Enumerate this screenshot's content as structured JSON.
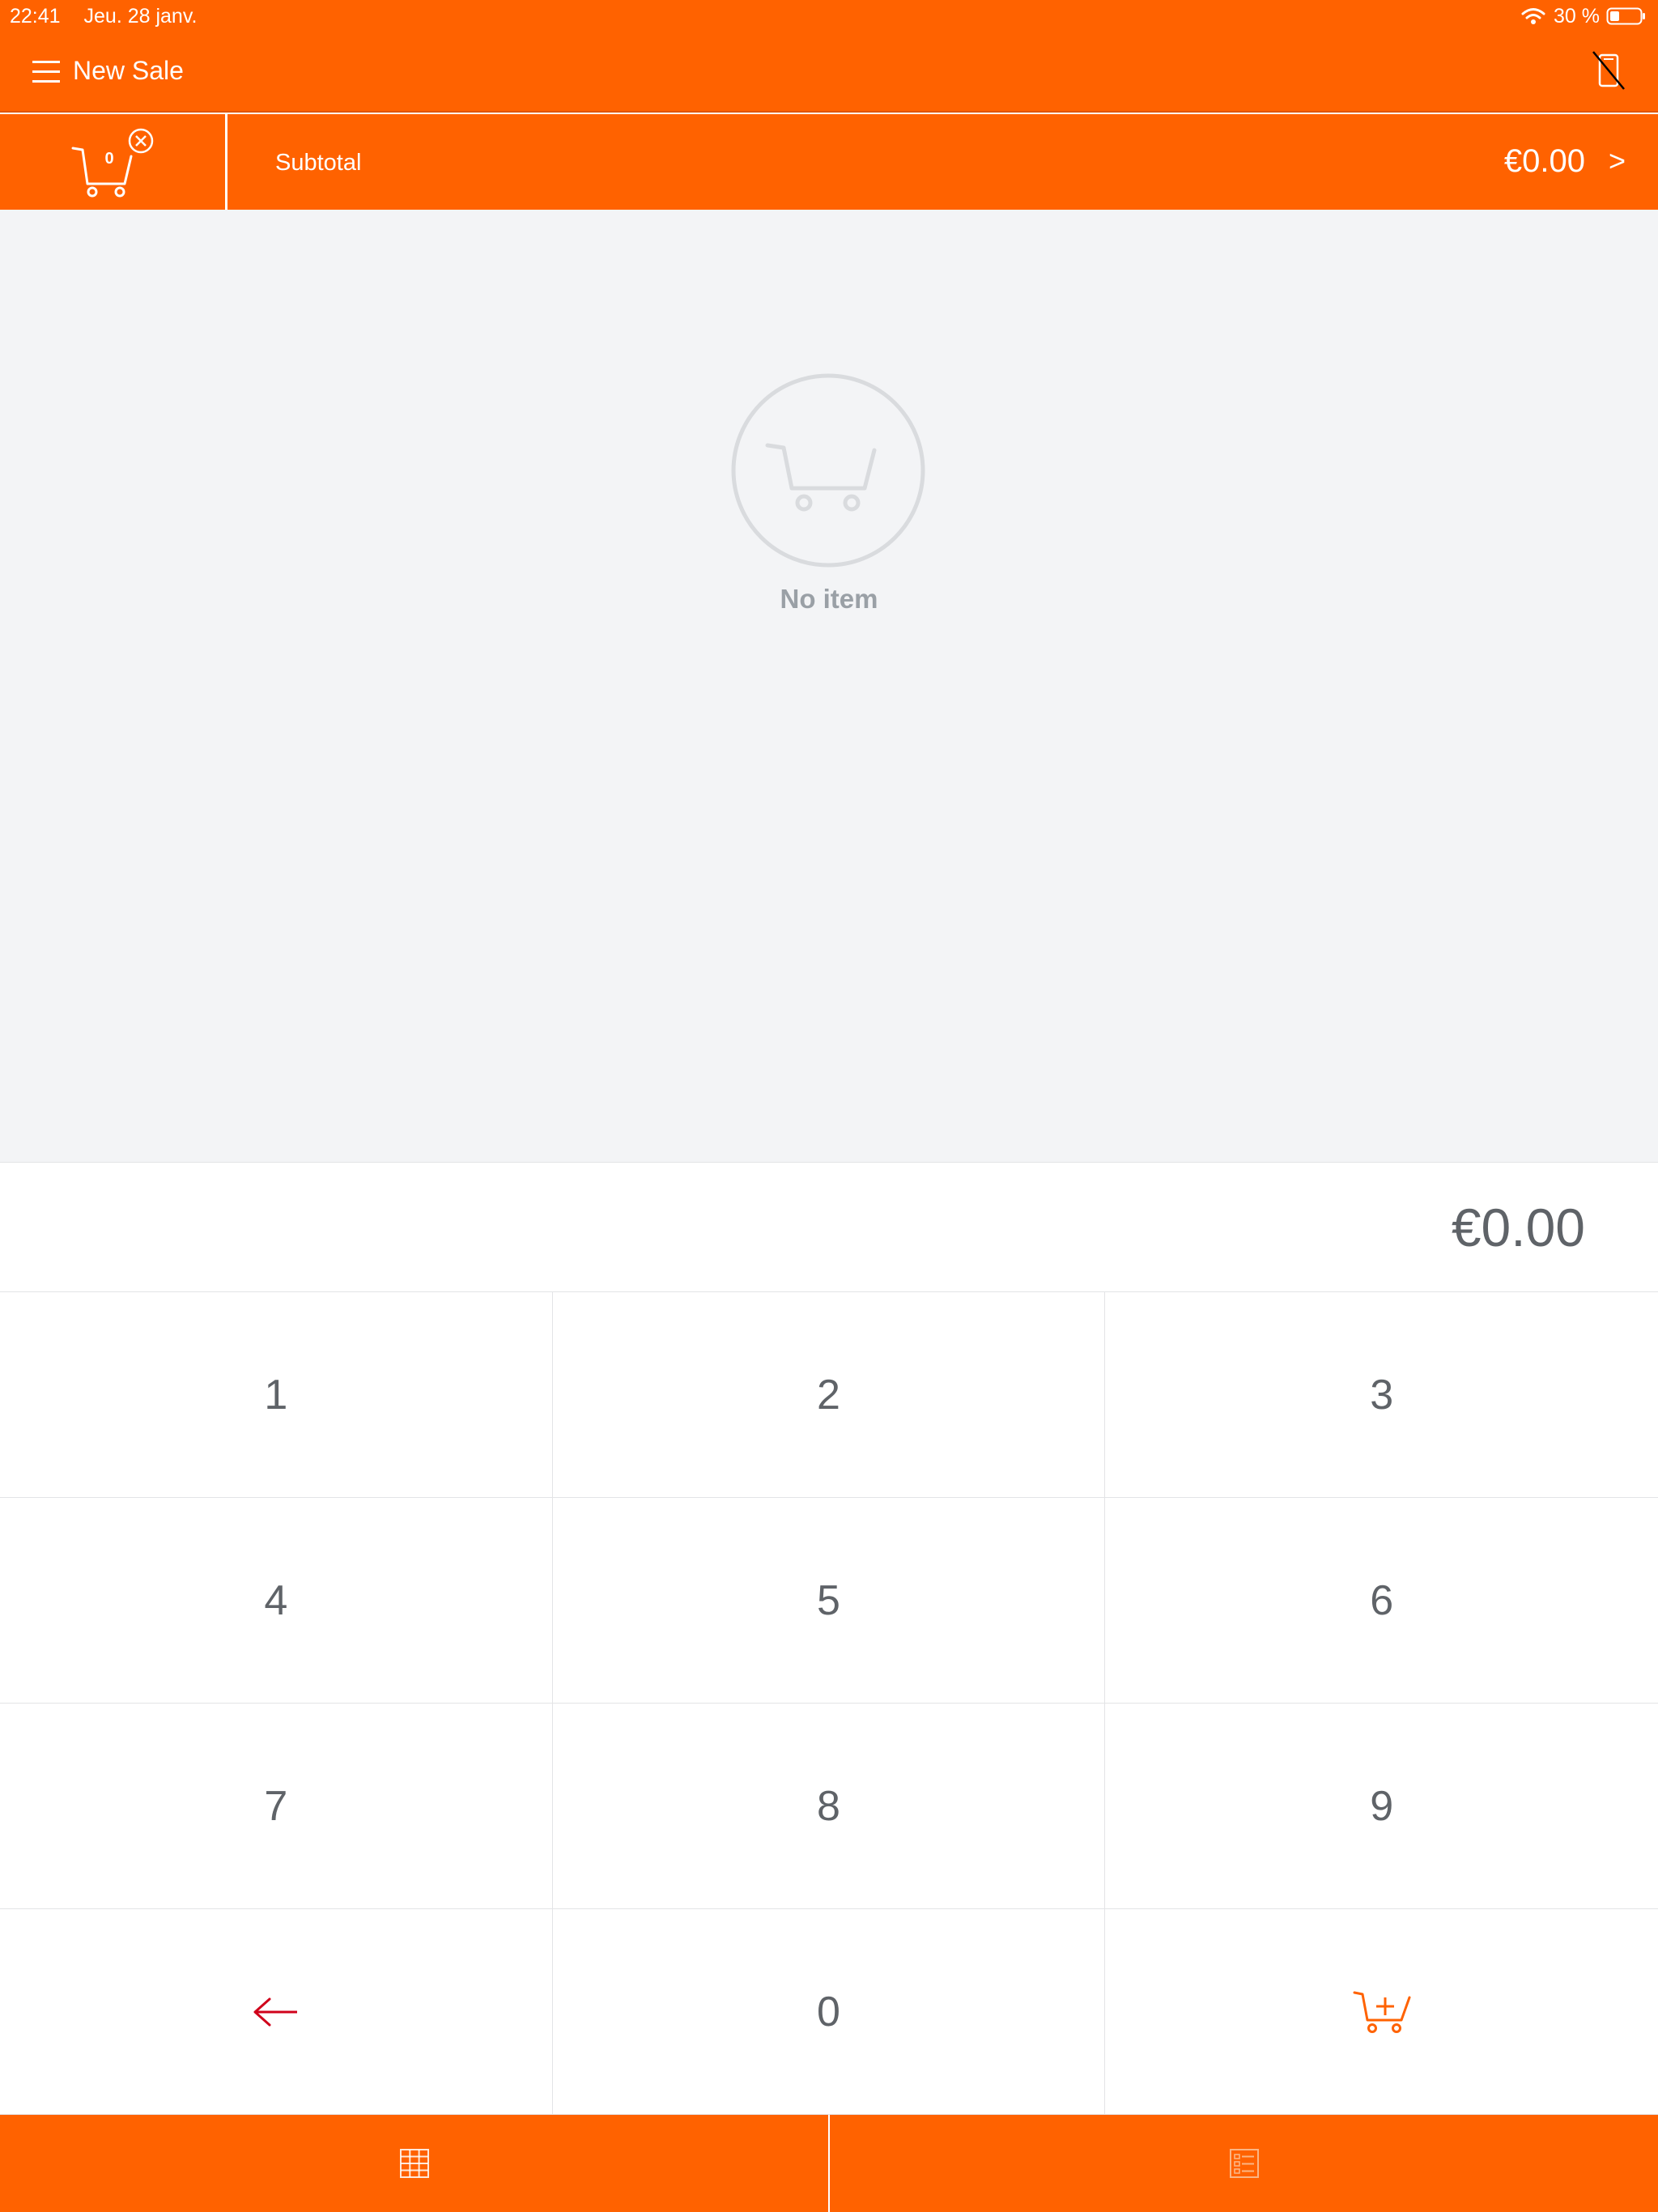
{
  "status_bar": {
    "time": "22:41",
    "date": "Jeu. 28 janv.",
    "battery": "30 %"
  },
  "header": {
    "title": "New Sale"
  },
  "cart_summary": {
    "item_count": "0",
    "subtotal_label": "Subtotal",
    "subtotal_value": "€0.00",
    "chevron": ">"
  },
  "items_panel": {
    "empty_message": "No item"
  },
  "amount_display": {
    "value": "€0.00"
  },
  "keypad": {
    "keys": [
      "1",
      "2",
      "3",
      "4",
      "5",
      "6",
      "7",
      "8",
      "9",
      "0"
    ],
    "backspace_icon": "arrow-left-icon",
    "add_to_cart_icon": "cart-plus-icon"
  },
  "bottom_nav": {
    "left_icon": "grid-icon",
    "right_icon": "list-icon"
  },
  "colors": {
    "brand": "#ff6200",
    "background": "#f3f4f6",
    "text_gray": "#5f6368",
    "backspace_red": "#d0021b"
  }
}
